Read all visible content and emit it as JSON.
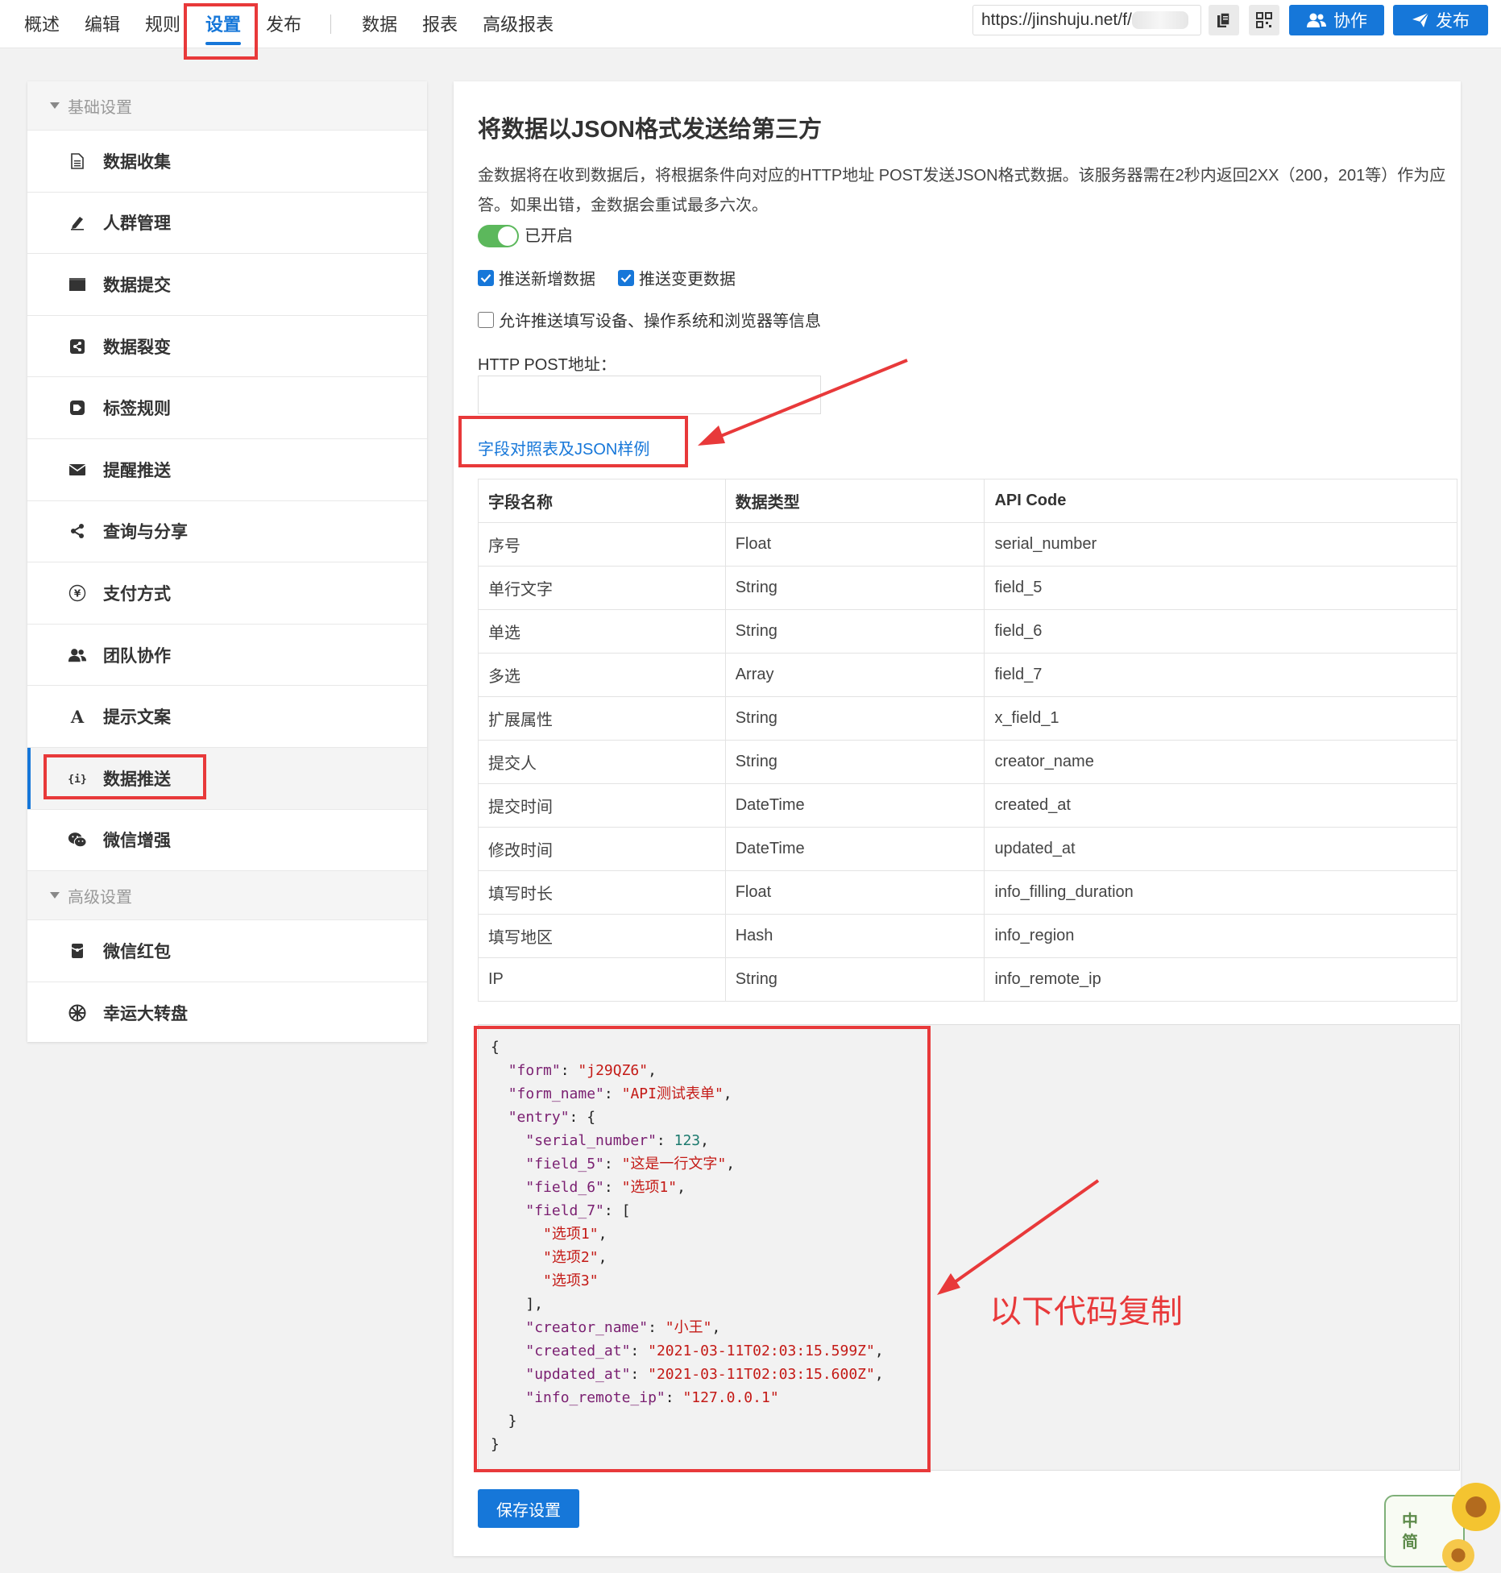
{
  "topnav": {
    "items": [
      "概述",
      "编辑",
      "规则",
      "设置",
      "发布"
    ],
    "items2": [
      "数据",
      "报表",
      "高级报表"
    ],
    "url": "https://jinshuju.net/f/",
    "collab_label": "协作",
    "publish_label": "发布"
  },
  "sidebar": {
    "group_basic": "基础设置",
    "group_advanced": "高级设置",
    "items": [
      {
        "label": "数据收集",
        "icon": "document-icon"
      },
      {
        "label": "人群管理",
        "icon": "pen-icon"
      },
      {
        "label": "数据提交",
        "icon": "window-icon"
      },
      {
        "label": "数据裂变",
        "icon": "share-square-icon"
      },
      {
        "label": "标签规则",
        "icon": "tag-icon"
      },
      {
        "label": "提醒推送",
        "icon": "envelope-icon"
      },
      {
        "label": "查询与分享",
        "icon": "share-icon"
      },
      {
        "label": "支付方式",
        "icon": "yen-icon"
      },
      {
        "label": "团队协作",
        "icon": "users-icon"
      },
      {
        "label": "提示文案",
        "icon": "font-icon"
      },
      {
        "label": "数据推送",
        "icon": "json-icon"
      },
      {
        "label": "微信增强",
        "icon": "wechat-icon"
      }
    ],
    "advanced_items": [
      {
        "label": "微信红包",
        "icon": "red-packet-icon"
      },
      {
        "label": "幸运大转盘",
        "icon": "wheel-icon"
      }
    ]
  },
  "main": {
    "title": "将数据以JSON格式发送给第三方",
    "description": "金数据将在收到数据后，将根据条件向对应的HTTP地址 POST发送JSON格式数据。该服务器需在2秒内返回2XX（200，201等）作为应答。如果出错，金数据会重试最多六次。",
    "toggle_label": "已开启",
    "checkbox_new": "推送新增数据",
    "checkbox_change": "推送变更数据",
    "checkbox_device": "允许推送填写设备、操作系统和浏览器等信息",
    "http_label": "HTTP POST地址：",
    "http_value": "",
    "link_text": "字段对照表及JSON样例",
    "save_label": "保存设置"
  },
  "table": {
    "headers": [
      "字段名称",
      "数据类型",
      "API Code"
    ],
    "rows": [
      [
        "序号",
        "Float",
        "serial_number"
      ],
      [
        "单行文字",
        "String",
        "field_5"
      ],
      [
        "单选",
        "String",
        "field_6"
      ],
      [
        "多选",
        "Array",
        "field_7"
      ],
      [
        "扩展属性",
        "String",
        "x_field_1"
      ],
      [
        "提交人",
        "String",
        "creator_name"
      ],
      [
        "提交时间",
        "DateTime",
        "created_at"
      ],
      [
        "修改时间",
        "DateTime",
        "updated_at"
      ],
      [
        "填写时长",
        "Float",
        "info_filling_duration"
      ],
      [
        "填写地区",
        "Hash",
        "info_region"
      ],
      [
        "IP",
        "String",
        "info_remote_ip"
      ]
    ]
  },
  "json_sample": {
    "form": "j29QZ6",
    "form_name": "API测试表单",
    "serial_number": "123",
    "field_5": "这是一行文字",
    "field_6": "选项1",
    "field_7": [
      "选项1",
      "选项2",
      "选项3"
    ],
    "creator_name": "小王",
    "created_at": "2021-03-11T02:03:15.599Z",
    "updated_at": "2021-03-11T02:03:15.600Z",
    "info_remote_ip": "127.0.0.1"
  },
  "annotation": {
    "copy_hint": "以下代码复制",
    "color": "#e8393a"
  },
  "sticker": {
    "line1": "中",
    "line2": "简"
  },
  "colors": {
    "accent": "#1677d9",
    "toggle_on": "#5cb85c"
  }
}
